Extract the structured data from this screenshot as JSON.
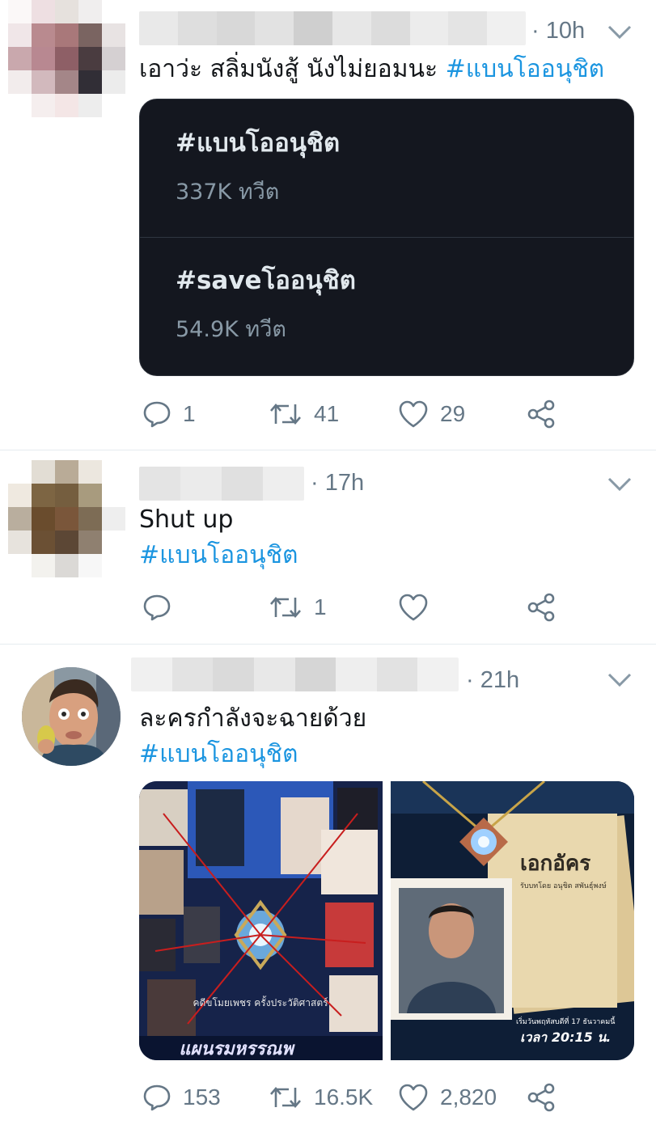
{
  "tweets": [
    {
      "time": "· 10h",
      "text": "เอาว่ะ สลิ่มนังสู้ นังไม่ยอมนะ ",
      "hashtag": "#แบนโออนุชิต",
      "card": {
        "trends": [
          {
            "name": "#แบนโออนุชิต",
            "count": "337K ทวีต"
          },
          {
            "name": "#saveโออนุชิต",
            "count": "54.9K ทวีต"
          }
        ]
      },
      "actions": {
        "reply": "1",
        "retweet": "41",
        "like": "29"
      }
    },
    {
      "time": "· 17h",
      "text": "Shut up",
      "hashtag": "#แบนโออนุชิต",
      "actions": {
        "reply": "",
        "retweet": "1",
        "like": ""
      }
    },
    {
      "time": "· 21h",
      "text": "ละครกำลังจะฉายด้วย",
      "hashtag": "#แบนโออนุชิต",
      "media": {
        "left_caption": "คดีขโมยเพชร ครั้งประวัติศาสตร์",
        "left_title": "แผนรมหรรณพ",
        "right_title": "เอกอัคร",
        "right_subtitle": "รับบทโดย อนุชิต สพันธุ์พงษ์",
        "right_date": "เริ่มวันพฤหัสบดีที่ 17 ธันวาคมนี้",
        "right_time": "เวลา 20:15 น."
      },
      "actions": {
        "reply": "153",
        "retweet": "16.5K",
        "like": "2,820"
      }
    }
  ],
  "colors": {
    "accent": "#1b95e0",
    "muted": "#657786",
    "card_bg": "#14171f"
  }
}
